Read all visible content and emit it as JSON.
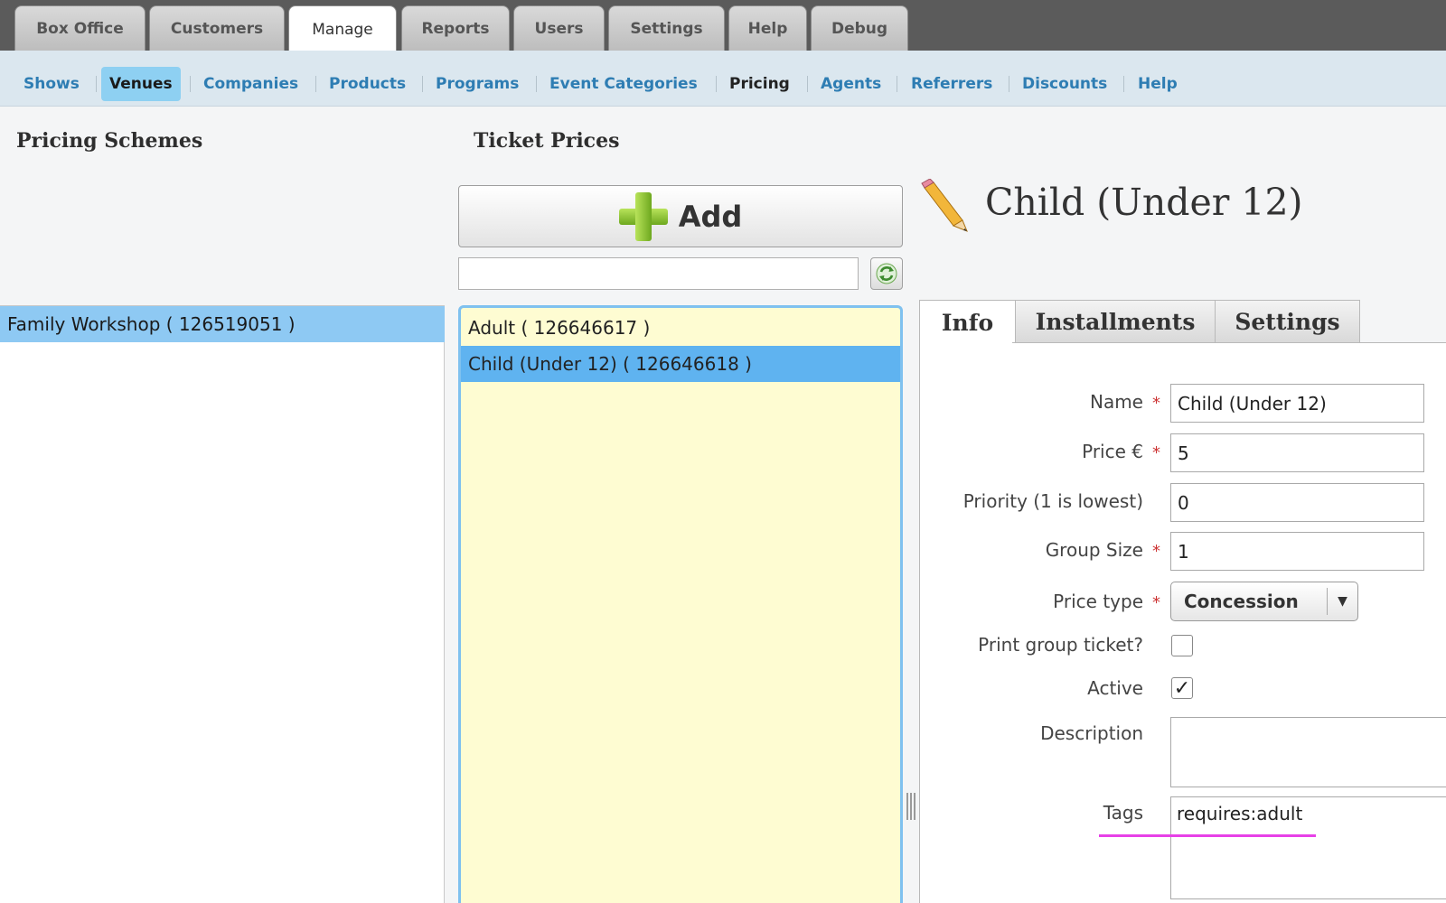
{
  "top_tabs": [
    {
      "label": "Box Office"
    },
    {
      "label": "Customers"
    },
    {
      "label": "Manage"
    },
    {
      "label": "Reports"
    },
    {
      "label": "Users"
    },
    {
      "label": "Settings"
    },
    {
      "label": "Help"
    },
    {
      "label": "Debug"
    }
  ],
  "top_tabs_active": "Manage",
  "sub_nav": [
    {
      "label": "Shows"
    },
    {
      "label": "Venues"
    },
    {
      "label": "Companies"
    },
    {
      "label": "Products"
    },
    {
      "label": "Programs"
    },
    {
      "label": "Event Categories"
    },
    {
      "label": "Pricing"
    },
    {
      "label": "Agents"
    },
    {
      "label": "Referrers"
    },
    {
      "label": "Discounts"
    },
    {
      "label": "Help"
    }
  ],
  "pricing_schemes": {
    "heading": "Pricing Schemes",
    "items": [
      {
        "label": "Family Workshop ( 126519051 )"
      }
    ]
  },
  "ticket_prices": {
    "heading": "Ticket Prices",
    "add_label": "Add",
    "filter_value": "",
    "items": [
      {
        "label": "Adult ( 126646617 )"
      },
      {
        "label": "Child (Under 12) ( 126646618 )"
      }
    ]
  },
  "detail": {
    "title": "Child (Under 12)",
    "tabs": [
      {
        "label": "Info"
      },
      {
        "label": "Installments"
      },
      {
        "label": "Settings"
      }
    ],
    "form": {
      "name_label": "Name",
      "name_value": "Child (Under 12)",
      "price_label": "Price €",
      "price_value": "5",
      "priority_label": "Priority (1 is lowest)",
      "priority_value": "0",
      "group_size_label": "Group Size",
      "group_size_value": "1",
      "price_type_label": "Price type",
      "price_type_value": "Concession",
      "print_group_label": "Print group ticket?",
      "print_group_checked": false,
      "active_label": "Active",
      "active_checked": true,
      "description_label": "Description",
      "description_value": "",
      "tags_label": "Tags",
      "tags_value": "requires:adult",
      "required_marker": "*",
      "check_mark": "✓"
    }
  },
  "colors": {
    "selection_blue": "#8ec9f3",
    "list_yellow": "#fefcd2",
    "link_blue": "#2e7db3",
    "annotation_magenta": "#e740e7"
  }
}
